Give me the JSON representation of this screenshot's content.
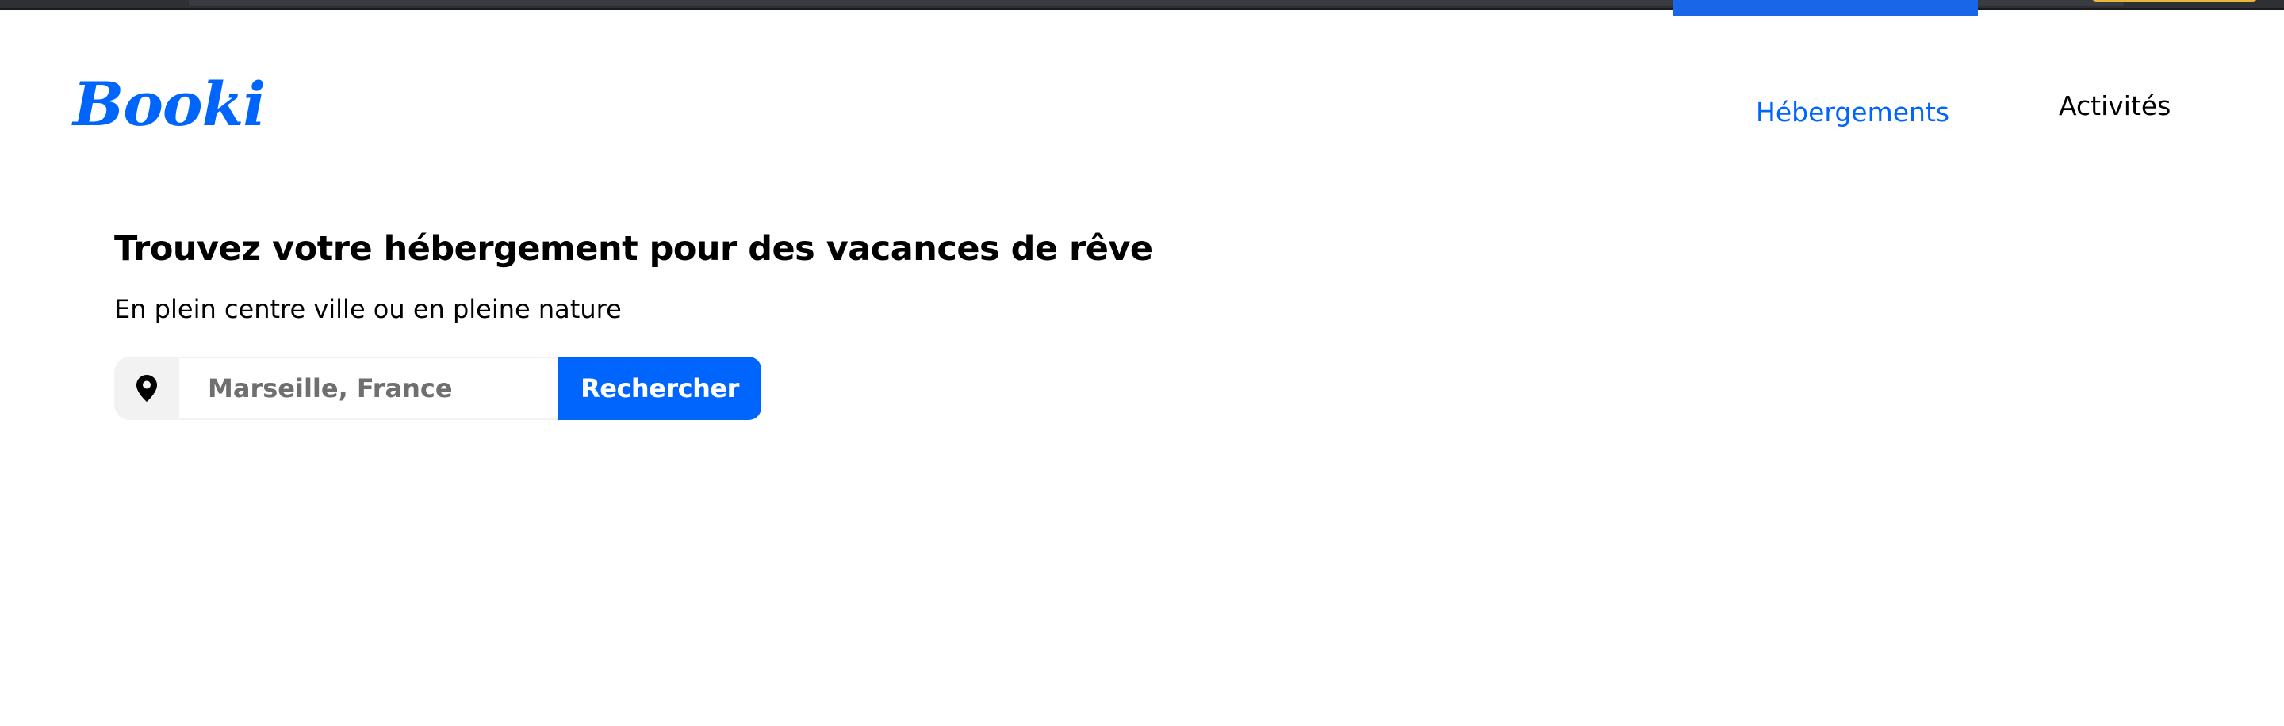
{
  "header": {
    "logo_text": "Booki",
    "nav": [
      {
        "label": "Hébergements",
        "active": true
      },
      {
        "label": "Activités",
        "active": false
      }
    ]
  },
  "hero": {
    "title": "Trouvez votre hébergement pour des vacances de rêve",
    "subtitle": "En plein centre ville ou en pleine nature"
  },
  "search": {
    "icon": "location-pin-icon",
    "placeholder": "Marseille, France",
    "value": "",
    "button_label": "Rechercher"
  },
  "colors": {
    "brand": "#0065fc",
    "icon_bg": "#f2f2f2",
    "text": "#000000"
  }
}
